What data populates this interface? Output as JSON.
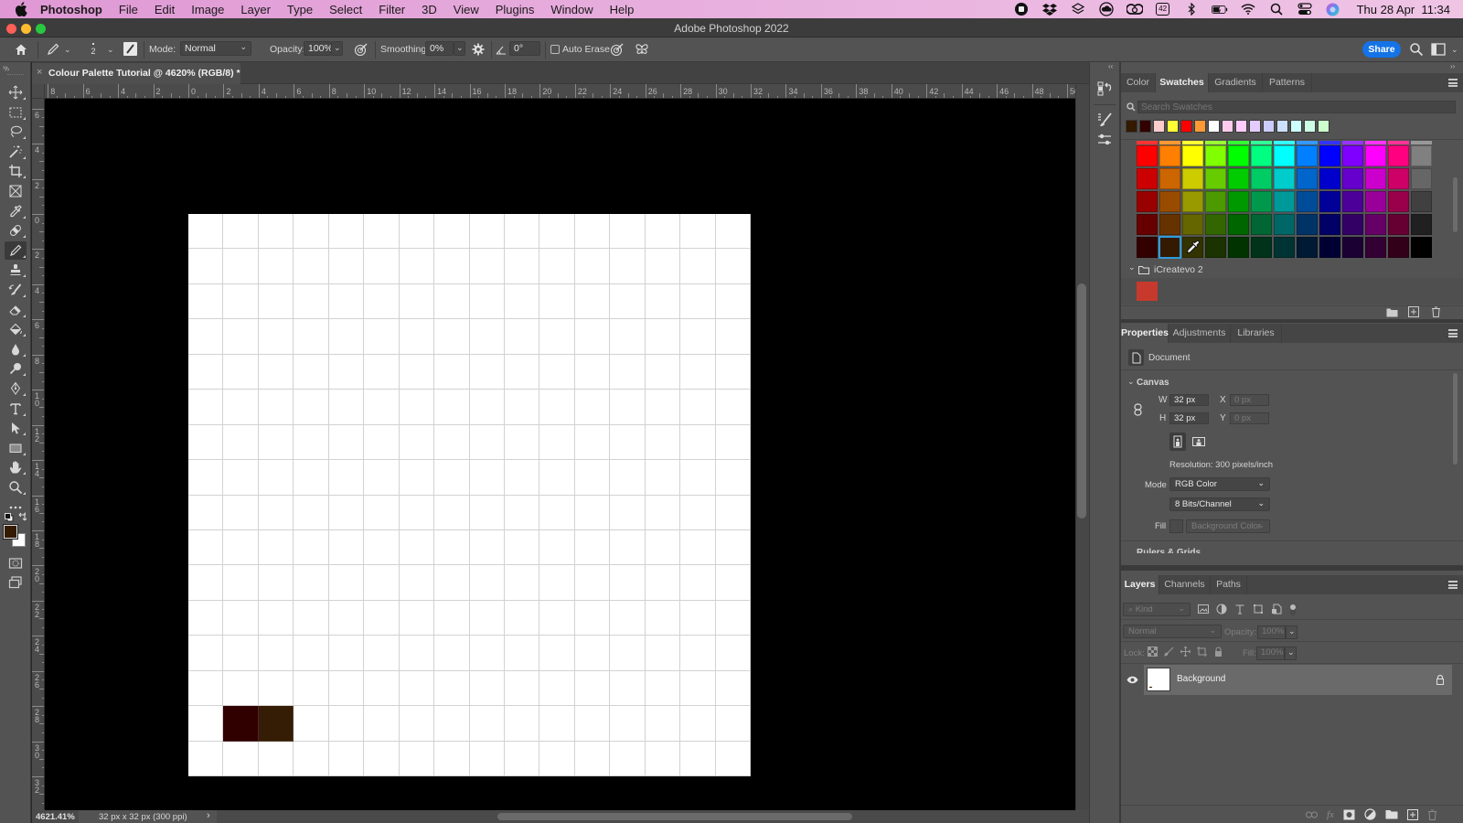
{
  "menubar": {
    "app_name": "Photoshop",
    "items": [
      "File",
      "Edit",
      "Image",
      "Layer",
      "Type",
      "Select",
      "Filter",
      "3D",
      "View",
      "Plugins",
      "Window",
      "Help"
    ],
    "status_icons": [
      "screen-record-icon",
      "dropbox-icon",
      "layers-app-icon",
      "cloud-icon",
      "creative-cloud-icon",
      "badge-42-icon",
      "bluetooth-icon",
      "battery-charging-icon",
      "wifi-icon",
      "spotlight-search-icon",
      "control-center-icon",
      "siri-icon"
    ],
    "badge_text": "42",
    "datetime": "Thu 28 Apr  11:34"
  },
  "window": {
    "title": "Adobe Photoshop 2022"
  },
  "options_bar": {
    "brush_size": "2",
    "mode_label": "Mode:",
    "mode_value": "Normal",
    "opacity_label": "Opacity:",
    "opacity_value": "100%",
    "smoothing_label": "Smoothing:",
    "smoothing_value": "0%",
    "angle_value": "0°",
    "auto_erase_label": "Auto Erase",
    "auto_erase_checked": false,
    "share_label": "Share"
  },
  "document": {
    "tab_title": "Colour Palette Tutorial @ 4620% (RGB/8) *",
    "grid_cells": 16,
    "background_color": "#ffffff",
    "painted_cells": [
      {
        "row": 14,
        "col": 1,
        "color": "#300000"
      },
      {
        "row": 14,
        "col": 2,
        "color": "#341c05"
      }
    ]
  },
  "rulers": {
    "horizontal": [
      "8",
      "6",
      "4",
      "2",
      "0",
      "2",
      "4",
      "6",
      "8",
      "10",
      "12",
      "14",
      "16",
      "18",
      "20",
      "22",
      "24",
      "26",
      "28",
      "30",
      "32",
      "34",
      "36",
      "38",
      "40",
      "42",
      "44",
      "46",
      "48",
      "50"
    ],
    "vertical": [
      "6",
      "4",
      "2",
      "0",
      "2",
      "4",
      "6",
      "8",
      "10",
      "12",
      "14",
      "16",
      "18",
      "20",
      "22",
      "24",
      "26",
      "28",
      "30",
      "32"
    ]
  },
  "tools": [
    {
      "id": "move",
      "active": false
    },
    {
      "id": "rectangular-marquee",
      "active": false
    },
    {
      "id": "lasso",
      "active": false
    },
    {
      "id": "magic-wand",
      "active": false
    },
    {
      "id": "crop",
      "active": false
    },
    {
      "id": "frame",
      "active": false
    },
    {
      "id": "eyedropper",
      "active": false
    },
    {
      "id": "spot-healing-brush",
      "active": false
    },
    {
      "id": "pencil",
      "active": true
    },
    {
      "id": "clone-stamp",
      "active": false
    },
    {
      "id": "history-brush",
      "active": false
    },
    {
      "id": "eraser",
      "active": false
    },
    {
      "id": "paint-bucket",
      "active": false
    },
    {
      "id": "blur",
      "active": false
    },
    {
      "id": "dodge",
      "active": false
    },
    {
      "id": "pen",
      "active": false
    },
    {
      "id": "type",
      "active": false
    },
    {
      "id": "path-selection",
      "active": false
    },
    {
      "id": "rectangle",
      "active": false
    },
    {
      "id": "hand",
      "active": false
    },
    {
      "id": "zoom",
      "active": false
    },
    {
      "id": "edit-toolbar",
      "active": false
    }
  ],
  "colors": {
    "foreground": "#331a00",
    "background": "#ffffff",
    "accent": "#1473e6",
    "selection": "#2d9cdb"
  },
  "status": {
    "zoom": "4621.41%",
    "doc_info": "32 px x 32 px (300 ppi)",
    "arrow": "›"
  },
  "swatches_panel": {
    "tabs": [
      {
        "label": "Color",
        "active": false
      },
      {
        "label": "Swatches",
        "active": true
      },
      {
        "label": "Gradients",
        "active": false
      },
      {
        "label": "Patterns",
        "active": false
      }
    ],
    "search_placeholder": "Search Swatches",
    "recent": [
      "#331a00",
      "#330000",
      "#ffcccc",
      "#ffff33",
      "#ff0000",
      "#ff9933",
      "#ffffff",
      "#ffccee",
      "#ffccff",
      "#e5ccff",
      "#ccccff",
      "#cce0ff",
      "#ccffff",
      "#ccffe5",
      "#ccffcc"
    ],
    "partial_row": [
      "#ff3333",
      "#ff9933",
      "#ffff33",
      "#99ff33",
      "#33ff33",
      "#33ff99",
      "#33ffff",
      "#3399ff",
      "#3333ff",
      "#9933ff",
      "#ff33ff",
      "#ff3399",
      "#999999"
    ],
    "grid": [
      [
        "#ff0000",
        "#ff8000",
        "#ffff00",
        "#80ff00",
        "#00ff00",
        "#00ff80",
        "#00ffff",
        "#0080ff",
        "#0000ff",
        "#8000ff",
        "#ff00ff",
        "#ff0080",
        "#808080"
      ],
      [
        "#cc0000",
        "#cc6600",
        "#cccc00",
        "#66cc00",
        "#00cc00",
        "#00cc66",
        "#00cccc",
        "#0066cc",
        "#0000cc",
        "#6600cc",
        "#cc00cc",
        "#cc0066",
        "#666666"
      ],
      [
        "#990000",
        "#994c00",
        "#999900",
        "#4c9900",
        "#009900",
        "#00994c",
        "#009999",
        "#004c99",
        "#000099",
        "#4c0099",
        "#990099",
        "#99004c",
        "#404040"
      ],
      [
        "#660000",
        "#663300",
        "#666600",
        "#336600",
        "#006600",
        "#006633",
        "#006666",
        "#003366",
        "#000066",
        "#330066",
        "#660066",
        "#660033",
        "#202020"
      ],
      [
        "#330000",
        "#331a00",
        "#333300",
        "#1a3300",
        "#003300",
        "#00331a",
        "#003333",
        "#001a33",
        "#000033",
        "#1a0033",
        "#330033",
        "#33001a",
        "#000000"
      ]
    ],
    "selected": {
      "row": 4,
      "col": 1
    },
    "cursor_over": {
      "row": 4,
      "col": 2
    },
    "group": {
      "name": "iCreatevo 2",
      "swatches": [
        "#c8392d"
      ]
    }
  },
  "properties_panel": {
    "tabs": [
      {
        "label": "Properties",
        "active": true
      },
      {
        "label": "Adjustments",
        "active": false
      },
      {
        "label": "Libraries",
        "active": false
      }
    ],
    "document_label": "Document",
    "section_title": "Canvas",
    "w_label": "W",
    "w_value": "32 px",
    "h_label": "H",
    "h_value": "32 px",
    "x_label": "X",
    "x_value": "0 px",
    "y_label": "Y",
    "y_value": "0 px",
    "resolution": "Resolution: 300 pixels/inch",
    "mode_label": "Mode",
    "mode_value": "RGB Color",
    "depth_value": "8 Bits/Channel",
    "fill_label": "Fill",
    "fill_value": "Background Color",
    "next_section": "Rulers & Grids"
  },
  "layers_panel": {
    "tabs": [
      {
        "label": "Layers",
        "active": true
      },
      {
        "label": "Channels",
        "active": false
      },
      {
        "label": "Paths",
        "active": false
      }
    ],
    "filter_kind": "Kind",
    "blend_mode": "Normal",
    "opacity_label": "Opacity:",
    "opacity_value": "100%",
    "lock_label": "Lock:",
    "fill_label": "Fill:",
    "fill_value": "100%",
    "layers": [
      {
        "name": "Background",
        "visible": true,
        "locked": true,
        "selected": true
      }
    ]
  }
}
